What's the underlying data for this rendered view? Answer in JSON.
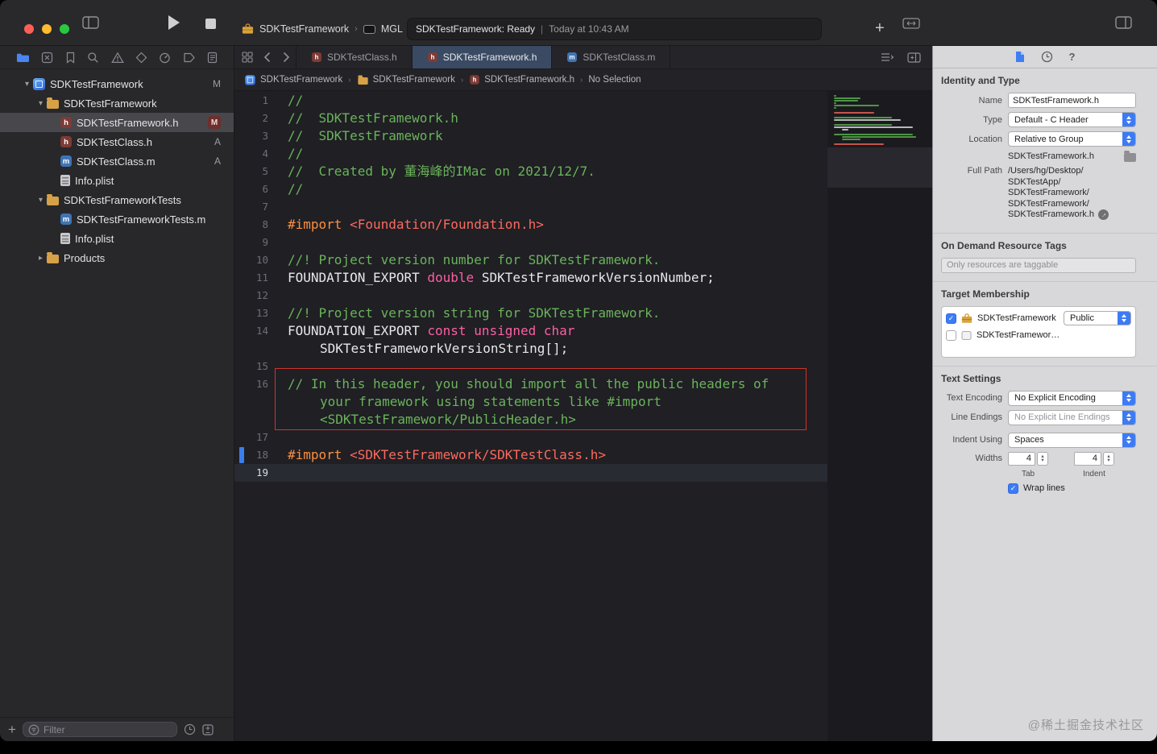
{
  "icons": {
    "plus": "+",
    "help": "?",
    "chevron_right": "›",
    "disclosure_open": "▾",
    "disclosure_closed": "▸",
    "check": "✓",
    "step_up": "▴",
    "step_down": "▾",
    "arrow_right": "→"
  },
  "toolbar": {
    "scheme_name": "SDKTestFramework",
    "run_destination": "MGL",
    "status": "SDKTestFramework: Ready",
    "status_divider": "|",
    "status_time": "Today at 10:43 AM"
  },
  "navigator": {
    "filter_placeholder": "Filter",
    "tree": [
      {
        "indent": 0,
        "disclosure": "open",
        "icon": "project",
        "label": "SDKTestFramework",
        "badge": "M"
      },
      {
        "indent": 1,
        "disclosure": "open",
        "icon": "folder",
        "label": "SDKTestFramework"
      },
      {
        "indent": 2,
        "icon": "h",
        "label": "SDKTestFramework.h",
        "badge": "M",
        "badge_style": "box",
        "selected": true
      },
      {
        "indent": 2,
        "icon": "h",
        "label": "SDKTestClass.h",
        "badge": "A"
      },
      {
        "indent": 2,
        "icon": "m",
        "label": "SDKTestClass.m",
        "badge": "A"
      },
      {
        "indent": 2,
        "icon": "plist",
        "label": "Info.plist"
      },
      {
        "indent": 1,
        "disclosure": "open",
        "icon": "folder",
        "label": "SDKTestFrameworkTests"
      },
      {
        "indent": 2,
        "icon": "m",
        "label": "SDKTestFrameworkTests.m"
      },
      {
        "indent": 2,
        "icon": "plist",
        "label": "Info.plist"
      },
      {
        "indent": 1,
        "disclosure": "closed",
        "icon": "folder",
        "label": "Products"
      }
    ]
  },
  "editor": {
    "tabs": [
      {
        "label": "SDKTestClass.h",
        "kind": "h",
        "active": false
      },
      {
        "label": "SDKTestFramework.h",
        "kind": "h",
        "active": true
      },
      {
        "label": "SDKTestClass.m",
        "kind": "m",
        "active": false
      }
    ],
    "jump_bar": [
      {
        "label": "SDKTestFramework",
        "icon": "project"
      },
      {
        "label": "SDKTestFramework",
        "icon": "folder"
      },
      {
        "label": "SDKTestFramework.h",
        "icon": "h"
      },
      {
        "label": "No Selection",
        "icon": null
      }
    ],
    "current_line": 19,
    "lines": [
      {
        "tokens": [
          [
            "c",
            "//"
          ]
        ]
      },
      {
        "tokens": [
          [
            "c",
            "//  SDKTestFramework.h"
          ]
        ]
      },
      {
        "tokens": [
          [
            "c",
            "//  SDKTestFramework"
          ]
        ]
      },
      {
        "tokens": [
          [
            "c",
            "//"
          ]
        ]
      },
      {
        "tokens": [
          [
            "c",
            "//  Created by 董海峰的IMac on 2021/12/7."
          ]
        ]
      },
      {
        "tokens": [
          [
            "c",
            "//"
          ]
        ]
      },
      {
        "tokens": []
      },
      {
        "tokens": [
          [
            "p",
            "#import"
          ],
          [
            "pl",
            " "
          ],
          [
            "s",
            "<Foundation/Foundation.h>"
          ]
        ]
      },
      {
        "tokens": []
      },
      {
        "tokens": [
          [
            "c",
            "//! Project version number for SDKTestFramework."
          ]
        ]
      },
      {
        "tokens": [
          [
            "pl",
            "FOUNDATION_EXPORT "
          ],
          [
            "k",
            "double"
          ],
          [
            "pl",
            " SDKTestFrameworkVersionNumber;"
          ]
        ]
      },
      {
        "tokens": []
      },
      {
        "tokens": [
          [
            "c",
            "//! Project version string for SDKTestFramework."
          ]
        ]
      },
      {
        "tokens": [
          [
            "pl",
            "FOUNDATION_EXPORT "
          ],
          [
            "k",
            "const unsigned char"
          ],
          [
            "pl",
            " SDKTestFrameworkVersionString[];"
          ]
        ]
      },
      {
        "tokens": []
      },
      {
        "tokens": [
          [
            "c",
            "// In this header, you should import all the public headers of your framework using statements like #import <SDKTestFramework/PublicHeader.h>"
          ]
        ],
        "boxed": true
      },
      {
        "tokens": []
      },
      {
        "tokens": [
          [
            "p",
            "#import"
          ],
          [
            "pl",
            " "
          ],
          [
            "s",
            "<SDKTestFramework/SDKTestClass.h>"
          ]
        ],
        "marker": true
      },
      {
        "tokens": []
      }
    ]
  },
  "inspector": {
    "identity": {
      "title": "Identity and Type",
      "name_label": "Name",
      "name_value": "SDKTestFramework.h",
      "type_label": "Type",
      "type_value": "Default - C Header",
      "location_label": "Location",
      "location_value": "Relative to Group",
      "file_name": "SDKTestFramework.h",
      "full_path_label": "Full Path",
      "full_path_lines": [
        "/Users/hg/Desktop/",
        "SDKTestApp/",
        "SDKTestFramework/",
        "SDKTestFramework/",
        "SDKTestFramework.h"
      ]
    },
    "on_demand": {
      "title": "On Demand Resource Tags",
      "placeholder": "Only resources are taggable"
    },
    "target_membership": {
      "title": "Target Membership",
      "targets": [
        {
          "checked": true,
          "icon": "framework",
          "name": "SDKTestFramework",
          "access": "Public"
        },
        {
          "checked": false,
          "icon": "tests",
          "name": "SDKTestFramewor…"
        }
      ]
    },
    "text_settings": {
      "title": "Text Settings",
      "encoding_label": "Text Encoding",
      "encoding_value": "No Explicit Encoding",
      "line_endings_label": "Line Endings",
      "line_endings_value": "No Explicit Line Endings",
      "indent_label": "Indent Using",
      "indent_value": "Spaces",
      "widths_label": "Widths",
      "tab_width": "4",
      "indent_width": "4",
      "tab_caption": "Tab",
      "indent_caption": "Indent",
      "wrap_label": "Wrap lines"
    }
  },
  "watermark": "@稀土掘金技术社区",
  "colors": {
    "accent": "#3d7bf5",
    "editor_bg": "#1f1f24",
    "comment": "#6bb35a",
    "keyword": "#fc5fa3",
    "preprocessor": "#fd8f3f",
    "string": "#fc6a5d",
    "annotation_red": "#d0342c",
    "folder": "#d7a148"
  }
}
